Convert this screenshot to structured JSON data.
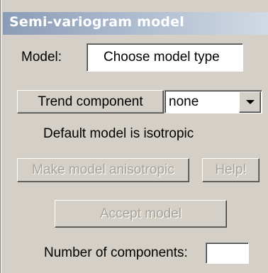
{
  "panel": {
    "title": "Semi-variogram model"
  },
  "model": {
    "label": "Model:",
    "value": "Choose model type"
  },
  "trend": {
    "button_label": "Trend component",
    "selected_option": "none",
    "dropdown_icon": "chevron-down-icon"
  },
  "info": {
    "default_text": "Default model is isotropic"
  },
  "buttons": {
    "anisotropic_label": "Make model anisotropic",
    "help_label": "Help!",
    "accept_label": "Accept model"
  },
  "components": {
    "label": "Number of components:",
    "value": ""
  },
  "colors": {
    "background": "#d4d0c8",
    "header_gradient_start": "#8a9cb6",
    "header_gradient_end": "#d1d9e4",
    "disabled_text": "#a7a39b"
  }
}
